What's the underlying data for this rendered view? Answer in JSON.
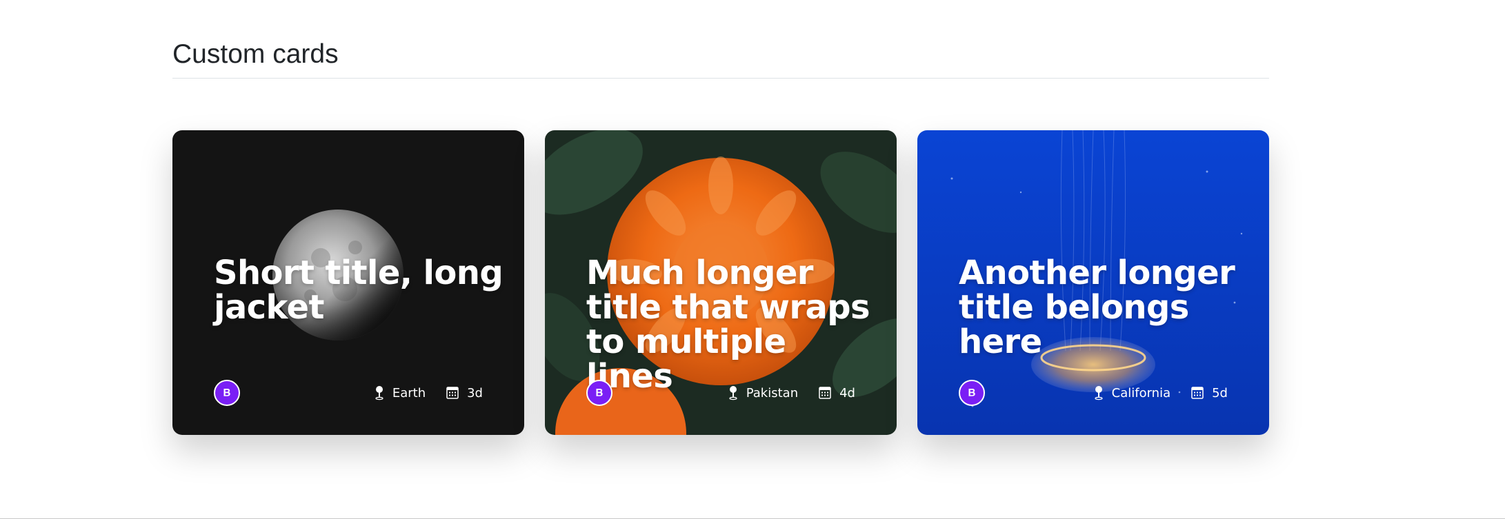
{
  "section": {
    "title": "Custom cards"
  },
  "cards": [
    {
      "title": "Short title, long jacket",
      "location": "Earth",
      "date": "3d",
      "background": "moon-image",
      "bg_color": "#111111"
    },
    {
      "title": "Much longer title that wraps to multiple lines",
      "location": "Pakistan",
      "date": "4d",
      "background": "orange-flower-image",
      "bg_color": "#1e2a20"
    },
    {
      "title": "Another longer title belongs here",
      "location": "California",
      "date": "5d",
      "background": "jellyfish-image",
      "bg_color": "#0a3cc8"
    }
  ],
  "icons": {
    "avatar": "bootstrap-logo-icon",
    "location": "geo-pin-icon",
    "date": "calendar-icon"
  },
  "colors": {
    "avatar_bg": "#7a1ff5",
    "heading_text": "#212529"
  }
}
